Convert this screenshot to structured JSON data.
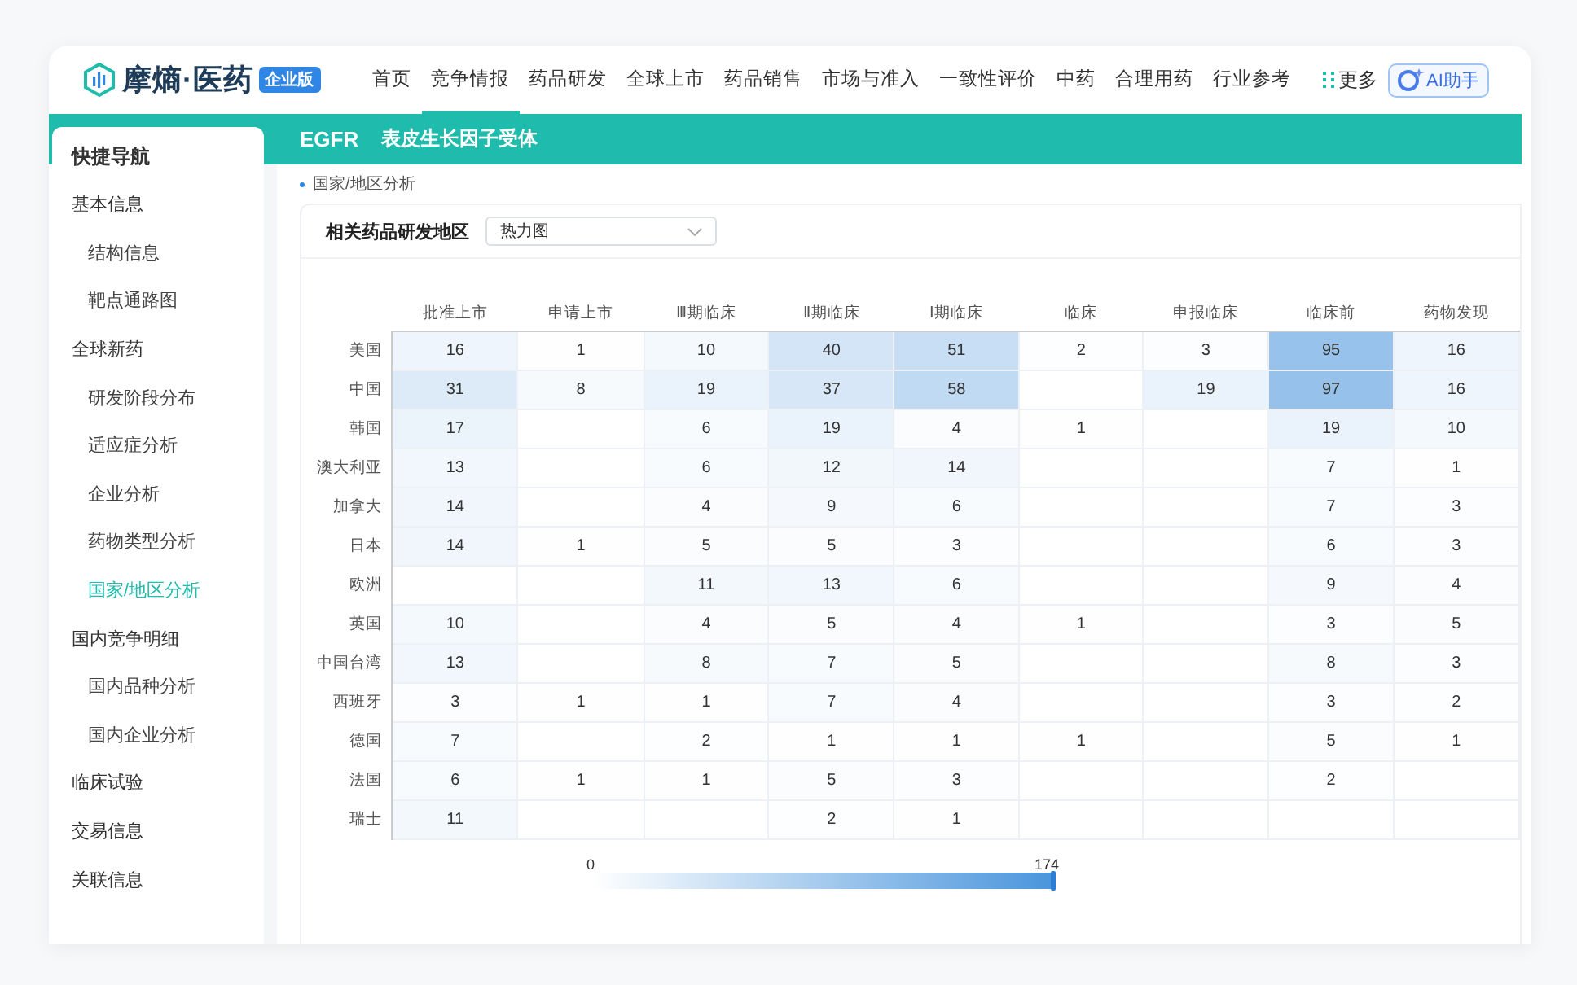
{
  "header": {
    "logo_text": "摩熵·医药",
    "logo_badge": "企业版",
    "nav": [
      {
        "label": "首页",
        "selected": false
      },
      {
        "label": "竞争情报",
        "selected": true
      },
      {
        "label": "药品研发",
        "selected": false
      },
      {
        "label": "全球上市",
        "selected": false
      },
      {
        "label": "药品销售",
        "selected": false
      },
      {
        "label": "市场与准入",
        "selected": false
      },
      {
        "label": "一致性评价",
        "selected": false
      },
      {
        "label": "中药",
        "selected": false
      },
      {
        "label": "合理用药",
        "selected": false
      },
      {
        "label": "行业参考",
        "selected": false
      }
    ],
    "more": "更多",
    "assistant": "AI助手"
  },
  "title_bar": {
    "code": "EGFR",
    "name": "表皮生长因子受体"
  },
  "sidebar": {
    "title": "快捷导航",
    "items": [
      {
        "label": "基本信息",
        "selected": false,
        "children": [
          {
            "label": "结构信息",
            "selected": false
          },
          {
            "label": "靶点通路图",
            "selected": false
          }
        ]
      },
      {
        "label": "全球新药",
        "selected": false,
        "children": [
          {
            "label": "研发阶段分布",
            "selected": false
          },
          {
            "label": "适应症分析",
            "selected": false
          },
          {
            "label": "企业分析",
            "selected": false
          },
          {
            "label": "药物类型分析",
            "selected": false
          },
          {
            "label": "国家/地区分析",
            "selected": true
          }
        ]
      },
      {
        "label": "国内竞争明细",
        "selected": false,
        "children": [
          {
            "label": "国内品种分析",
            "selected": false
          },
          {
            "label": "国内企业分析",
            "selected": false
          }
        ]
      },
      {
        "label": "临床试验",
        "selected": false
      },
      {
        "label": "交易信息",
        "selected": false
      },
      {
        "label": "关联信息",
        "selected": false
      }
    ]
  },
  "section": {
    "label": "国家/地区分析",
    "filter_label": "相关药品研发地区",
    "select_value": "热力图"
  },
  "heatmap": {
    "columns": [
      "批准上市",
      "申请上市",
      "Ⅲ期临床",
      "Ⅱ期临床",
      "Ⅰ期临床",
      "临床",
      "申报临床",
      "临床前",
      "药物发现"
    ],
    "rows": [
      {
        "label": "美国",
        "cells": [
          "16",
          "1",
          "10",
          "40",
          "51",
          "2",
          "3",
          "95",
          "16"
        ]
      },
      {
        "label": "中国",
        "cells": [
          "31",
          "8",
          "19",
          "37",
          "58",
          null,
          "19",
          "97",
          "16"
        ]
      },
      {
        "label": "韩国",
        "cells": [
          "17",
          null,
          "6",
          "19",
          "4",
          "1",
          null,
          "19",
          "10"
        ]
      },
      {
        "label": "澳大利亚",
        "cells": [
          "13",
          null,
          "6",
          "12",
          "14",
          null,
          null,
          "7",
          "1"
        ]
      },
      {
        "label": "加拿大",
        "cells": [
          "14",
          null,
          "4",
          "9",
          "6",
          null,
          null,
          "7",
          "3"
        ]
      },
      {
        "label": "日本",
        "cells": [
          "14",
          "1",
          "5",
          "5",
          "3",
          null,
          null,
          "6",
          "3"
        ]
      },
      {
        "label": "欧洲",
        "cells": [
          null,
          null,
          "11",
          "13",
          "6",
          null,
          null,
          "9",
          "4"
        ]
      },
      {
        "label": "英国",
        "cells": [
          "10",
          null,
          "4",
          "5",
          "4",
          "1",
          null,
          "3",
          "5"
        ]
      },
      {
        "label": "中国台湾",
        "cells": [
          "13",
          null,
          "8",
          "7",
          "5",
          null,
          null,
          "8",
          "3"
        ]
      },
      {
        "label": "西班牙",
        "cells": [
          "3",
          "1",
          "1",
          "7",
          "4",
          null,
          null,
          "3",
          "2"
        ]
      },
      {
        "label": "德国",
        "cells": [
          "7",
          null,
          "2",
          "1",
          "1",
          "1",
          null,
          "5",
          "1"
        ]
      },
      {
        "label": "法国",
        "cells": [
          "6",
          "1",
          "1",
          "5",
          "3",
          null,
          null,
          "2",
          null
        ]
      },
      {
        "label": "瑞士",
        "cells": [
          "11",
          null,
          null,
          "2",
          "1",
          null,
          null,
          null,
          null
        ]
      }
    ],
    "legend_min": "0",
    "legend_max": "174"
  }
}
